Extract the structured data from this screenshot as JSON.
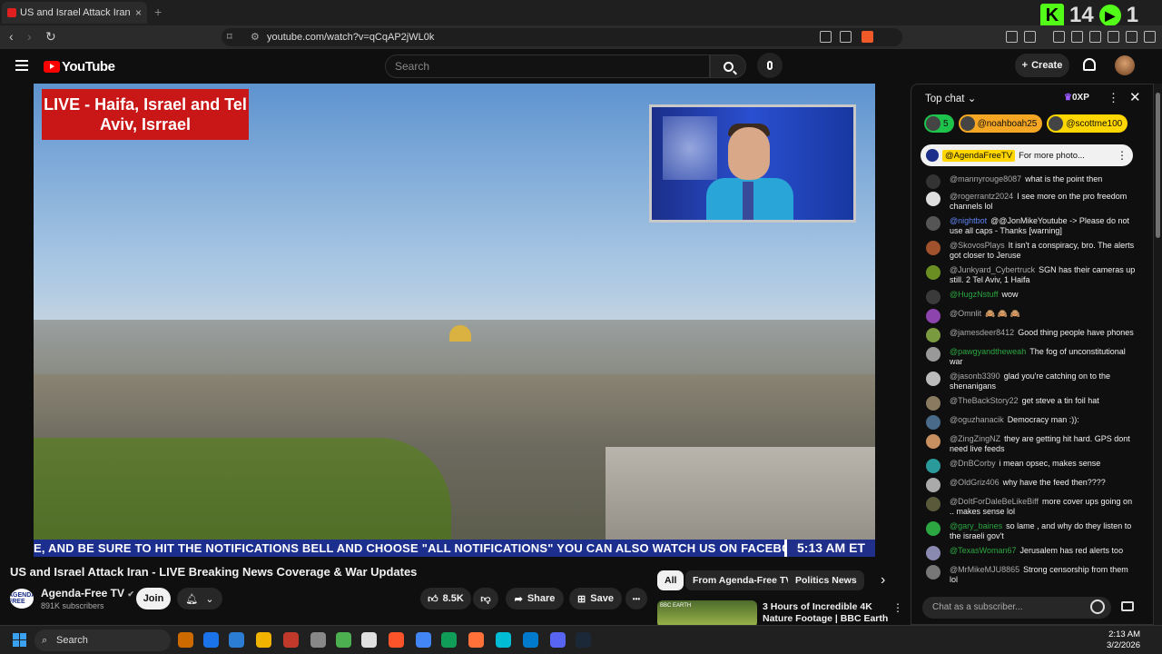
{
  "browser": {
    "tab_title": "US and Israel Attack Iran - LIV",
    "tab_close": "×",
    "new_tab": "+",
    "url": "youtube.com/watch?v=qCqAP2jWL0k",
    "kick_count_a": "14",
    "kick_count_b": "1",
    "brave_badge": "1"
  },
  "youtube": {
    "logo_text": "YouTube",
    "search_placeholder": "Search",
    "create_label": "Create"
  },
  "video": {
    "live_banner": "LIVE - Haifa, Israel and Tel Aviv, Isrrael",
    "ticker_text": "E, AND BE SURE TO HIT THE NOTIFICATIONS BELL AND CHOOSE \"ALL NOTIFICATIONS\"      YOU CAN ALSO WATCH US ON FACEBOOK",
    "ticker_time": "5:13 AM ET",
    "title": "US and Israel Attack Iran - LIVE Breaking News Coverage & War Updates",
    "channel_name": "Agenda-Free TV",
    "channel_badge": "✔",
    "subscribers": "891K subscribers",
    "channel_avatar_text": "AGENDA FREE",
    "join_label": "Join",
    "likes": "8.5K",
    "share_label": "Share",
    "save_label": "Save",
    "more_label": "•••"
  },
  "recommendations": {
    "chips": [
      "All",
      "From Agenda-Free TV",
      "Politics News"
    ],
    "next_arrow": "›",
    "item_title": "3 Hours of Incredible 4K Nature Footage | BBC Earth",
    "item_thumb_label": "BBC EARTH"
  },
  "chat": {
    "mode": "Top chat",
    "xp_label": "0XP",
    "donors": [
      {
        "label": "5",
        "color": "#1ec34c"
      },
      {
        "label": "@noahboah25",
        "color": "#f5a623"
      },
      {
        "label": "@scottme100",
        "color": "#ffd600"
      }
    ],
    "pinned_author": "@AgendaFreeTV",
    "pinned_text": "For more photo...",
    "messages": [
      {
        "author": "@mannyrouge8087",
        "text": "what is the point then",
        "color": "#333",
        "style": ""
      },
      {
        "author": "@rogerrantz2024",
        "text": "I see more on the pro freedom channels lol",
        "color": "#ddd",
        "style": ""
      },
      {
        "author": "@nightbot",
        "text": "@@JonMikeYoutube -> Please do not use all caps - Thanks [warning]",
        "color": "#555",
        "style": "mod"
      },
      {
        "author": "@SkovosPlays",
        "text": "It isn't a conspiracy, bro. The alerts got closer to Jeruse",
        "color": "#a0522d",
        "style": ""
      },
      {
        "author": "@Junkyard_Cybertruck",
        "text": "SGN has their cameras up still. 2 Tel Aviv, 1 Haifa",
        "color": "#6b8e23",
        "style": ""
      },
      {
        "author": "@HugzNstuff",
        "text": "wow",
        "color": "#3a3a3a",
        "style": "mem"
      },
      {
        "author": "@Omnlit",
        "text": "🙈 🙈 🙈",
        "color": "#8e44ad",
        "style": ""
      },
      {
        "author": "@jamesdeer8412",
        "text": "Good thing people have phones",
        "color": "#7a9a40",
        "style": ""
      },
      {
        "author": "@pawgyandtheweah",
        "text": "The fog of unconstitutional war",
        "color": "#999",
        "style": "mem"
      },
      {
        "author": "@jasonb3390",
        "text": "glad you're catching on to the shenanigans",
        "color": "#bbb",
        "style": ""
      },
      {
        "author": "@TheBackStory22",
        "text": "get steve a tin foil hat",
        "color": "#8a7a60",
        "style": ""
      },
      {
        "author": "@oguzhanacik",
        "text": "Democracy man :)):",
        "color": "#4a6a8a",
        "style": ""
      },
      {
        "author": "@ZingZingNZ",
        "text": "they are getting hit hard. GPS dont need live feeds",
        "color": "#c89060",
        "style": ""
      },
      {
        "author": "@DnBCorby",
        "text": "i mean opsec, makes sense",
        "color": "#2a9a9a",
        "style": ""
      },
      {
        "author": "@OldGriz406",
        "text": "why have the feed then????",
        "color": "#aaa",
        "style": ""
      },
      {
        "author": "@DoItForDaleBeLikeBiff",
        "text": "more cover ups going on .. makes sense lol",
        "color": "#5a5a3a",
        "style": ""
      },
      {
        "author": "@gary_baines",
        "text": "so lame , and why do they listen to the israeli gov't",
        "color": "#2ba640",
        "style": "mem"
      },
      {
        "author": "@TexasWoman67",
        "text": "Jerusalem has red alerts too",
        "color": "#8a8ab0",
        "style": "mem"
      },
      {
        "author": "@MrMikeMJU8865",
        "text": "Strong censorship from them lol",
        "color": "#777",
        "style": ""
      }
    ],
    "input_placeholder": "Chat as a subscriber..."
  },
  "taskbar": {
    "search_label": "Search",
    "time": "2:13 AM",
    "date": "3/2/2026"
  }
}
